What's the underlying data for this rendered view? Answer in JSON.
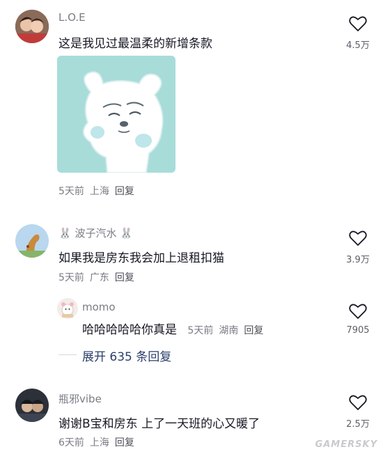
{
  "comments": [
    {
      "user": "L.O.E",
      "text": "这是我见过最温柔的新增条款",
      "time": "5天前",
      "location": "上海",
      "reply_label": "回复",
      "likes": "4.5万",
      "has_sticker": true
    },
    {
      "user": "🐰 波子汽水 🐰",
      "text": "如果我是房东我会加上退租扣猫",
      "time": "5天前",
      "location": "广东",
      "reply_label": "回复",
      "likes": "3.9万"
    },
    {
      "user": "瓶邪vibe",
      "text": "谢谢B宝和房东 上了一天班的心又暖了",
      "time": "6天前",
      "location": "上海",
      "reply_label": "回复",
      "likes": "2.5万"
    }
  ],
  "reply": {
    "user": "momo",
    "text": "哈哈哈哈哈你真是",
    "time": "5天前",
    "location": "湖南",
    "reply_label": "回复",
    "likes": "7905"
  },
  "expand_label": "展开 635 条回复",
  "watermark": "GAMERSKY",
  "icons": {
    "like": "heart-outline-icon"
  },
  "colors": {
    "sticker_bg": "#a8dcd9",
    "text": "#161823",
    "meta": "#7a7c85",
    "expand": "#2a3f6a"
  }
}
